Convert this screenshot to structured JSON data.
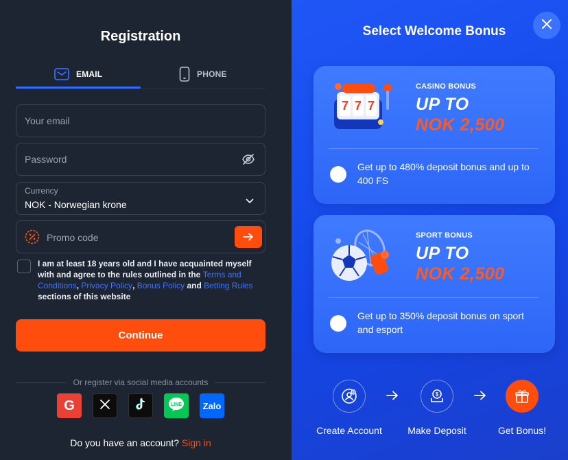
{
  "registration": {
    "title": "Registration",
    "tabs": [
      {
        "label": "EMAIL",
        "icon": "email-icon",
        "active": true
      },
      {
        "label": "PHONE",
        "icon": "phone-icon",
        "active": false
      }
    ],
    "email_placeholder": "Your email",
    "password_placeholder": "Password",
    "currency": {
      "label": "Currency",
      "value": "NOK - Norwegian krone"
    },
    "promo_placeholder": "Promo code",
    "agreement": {
      "text_1": "I am at least 18 years old and I have acquainted myself with and agree to the rules outlined in the ",
      "link_terms": "Terms and Conditions",
      "sep_1": ", ",
      "link_privacy": "Privacy Policy",
      "sep_2": ", ",
      "link_bonus": "Bonus Policy",
      "and": " and ",
      "link_betting": "Betting Rules",
      "text_2": " sections of this website"
    },
    "continue_label": "Continue",
    "social_title": "Or register via social media accounts",
    "socials": [
      "G",
      "X",
      "TikTok",
      "LINE",
      "Zalo"
    ],
    "login_prompt": "Do you have an account?",
    "login_link": "Sign in"
  },
  "welcome": {
    "title": "Select Welcome Bonus",
    "bonuses": [
      {
        "category": "CASINO BONUS",
        "headline": "UP TO",
        "amount": "NOK 2,500",
        "description": "Get up to 480% deposit bonus and up to 400 FS"
      },
      {
        "category": "SPORT BONUS",
        "headline": "UP TO",
        "amount": "NOK 2,500",
        "description": "Get up to 350% deposit bonus on sport and esport"
      }
    ],
    "steps": [
      {
        "label": "Create Account",
        "icon": "user-add-icon"
      },
      {
        "label": "Make Deposit",
        "icon": "deposit-icon"
      },
      {
        "label": "Get Bonus!",
        "icon": "gift-icon"
      }
    ]
  },
  "colors": {
    "accent": "#ff4d0d",
    "primary_blue": "#1f57f5",
    "dark_bg": "#1d2533",
    "link": "#3f74ff"
  }
}
